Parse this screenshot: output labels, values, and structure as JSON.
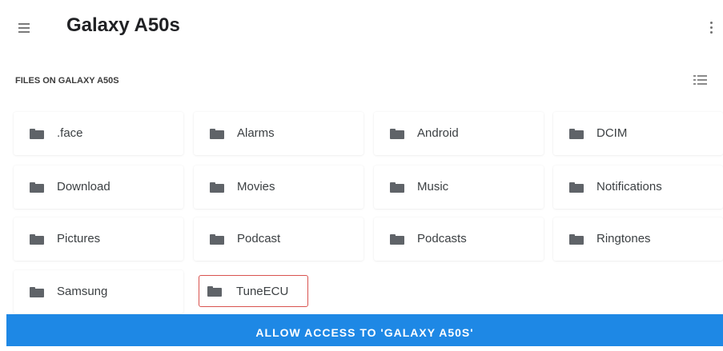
{
  "header": {
    "title": "Galaxy A50s",
    "menu_icon": "hamburger-menu-icon",
    "more_icon": "more-vertical-icon"
  },
  "files": {
    "section_label": "FILES ON GALAXY A50S",
    "view_toggle_icon": "list-view-icon",
    "folders": [
      {
        "label": ".face"
      },
      {
        "label": "Alarms"
      },
      {
        "label": "Android"
      },
      {
        "label": "DCIM"
      },
      {
        "label": "Download"
      },
      {
        "label": "Movies"
      },
      {
        "label": "Music"
      },
      {
        "label": "Notifications"
      },
      {
        "label": "Pictures"
      },
      {
        "label": "Podcast"
      },
      {
        "label": "Podcasts"
      },
      {
        "label": "Ringtones"
      },
      {
        "label": "Samsung"
      },
      {
        "label": "TuneECU",
        "selected": true
      }
    ],
    "folder_icon": "folder-icon"
  },
  "action": {
    "allow_label": "ALLOW ACCESS TO 'GALAXY A50S'"
  },
  "colors": {
    "primary": "#1e88e5",
    "selection_border": "#d9534f",
    "icon": "#5f6368"
  }
}
